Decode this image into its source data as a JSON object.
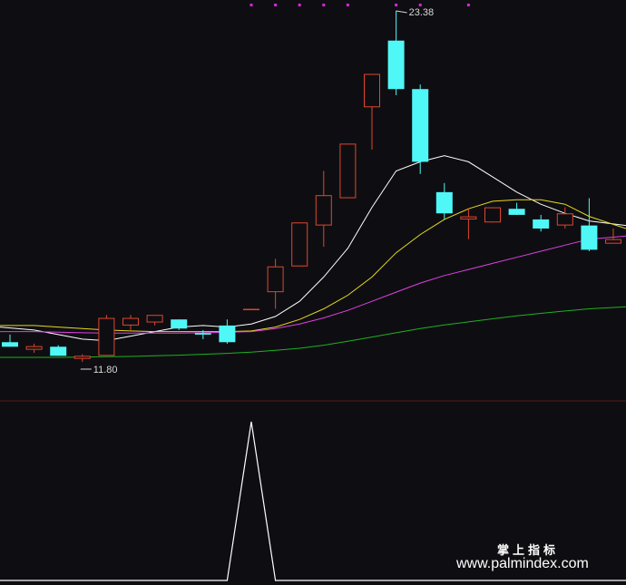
{
  "chart_data": [
    {
      "type": "candlestick",
      "ylim": [
        10.0,
        24.0
      ],
      "candles": [
        {
          "o": 12.45,
          "h": 12.7,
          "l": 12.3,
          "c": 12.3
        },
        {
          "o": 12.2,
          "h": 12.4,
          "l": 12.1,
          "c": 12.32
        },
        {
          "o": 12.3,
          "h": 12.35,
          "l": 12.0,
          "c": 12.0
        },
        {
          "o": 11.9,
          "h": 12.05,
          "l": 11.8,
          "c": 12.0
        },
        {
          "o": 12.0,
          "h": 13.35,
          "l": 12.0,
          "c": 13.25
        },
        {
          "o": 13.0,
          "h": 13.35,
          "l": 12.85,
          "c": 13.25
        },
        {
          "o": 13.1,
          "h": 13.35,
          "l": 13.0,
          "c": 13.35
        },
        {
          "o": 13.2,
          "h": 13.2,
          "l": 12.85,
          "c": 12.9
        },
        {
          "o": 12.75,
          "h": 12.85,
          "l": 12.55,
          "c": 12.7
        },
        {
          "o": 13.0,
          "h": 13.2,
          "l": 12.4,
          "c": 12.45
        },
        {
          "o": 13.55,
          "h": 13.55,
          "l": 13.55,
          "c": 13.55
        },
        {
          "o": 14.1,
          "h": 15.2,
          "l": 13.55,
          "c": 14.95
        },
        {
          "o": 14.95,
          "h": 16.4,
          "l": 14.95,
          "c": 16.4
        },
        {
          "o": 16.3,
          "h": 18.1,
          "l": 15.6,
          "c": 17.3
        },
        {
          "o": 17.2,
          "h": 19.0,
          "l": 17.2,
          "c": 19.0
        },
        {
          "o": 20.2,
          "h": 21.3,
          "l": 18.8,
          "c": 21.3
        },
        {
          "o": 22.4,
          "h": 23.38,
          "l": 20.6,
          "c": 20.8
        },
        {
          "o": 20.8,
          "h": 20.95,
          "l": 18.0,
          "c": 18.4
        },
        {
          "o": 17.4,
          "h": 17.7,
          "l": 16.5,
          "c": 16.7
        },
        {
          "o": 16.5,
          "h": 16.85,
          "l": 15.85,
          "c": 16.6
        },
        {
          "o": 16.4,
          "h": 16.9,
          "l": 16.4,
          "c": 16.9
        },
        {
          "o": 16.85,
          "h": 17.05,
          "l": 16.65,
          "c": 16.65
        },
        {
          "o": 16.5,
          "h": 16.65,
          "l": 16.1,
          "c": 16.2
        },
        {
          "o": 16.3,
          "h": 16.9,
          "l": 16.2,
          "c": 16.7
        },
        {
          "o": 16.3,
          "h": 17.2,
          "l": 15.45,
          "c": 15.5
        },
        {
          "o": 15.7,
          "h": 16.2,
          "l": 15.7,
          "c": 15.85
        }
      ],
      "moving_averages": [
        {
          "color": "#ffffff",
          "values": [
            12.95,
            12.85,
            12.7,
            12.55,
            12.5,
            12.65,
            12.8,
            12.95,
            13.0,
            12.95,
            13.05,
            13.3,
            13.8,
            14.6,
            15.55,
            16.9,
            18.1,
            18.4,
            18.6,
            18.4,
            17.9,
            17.4,
            17.0,
            16.7,
            16.45,
            16.3
          ]
        },
        {
          "color": "#e8d820",
          "values": [
            13.0,
            13.0,
            12.95,
            12.9,
            12.85,
            12.82,
            12.8,
            12.8,
            12.8,
            12.8,
            12.82,
            12.95,
            13.2,
            13.55,
            14.0,
            14.6,
            15.4,
            16.0,
            16.5,
            16.85,
            17.1,
            17.15,
            17.15,
            17.0,
            16.6,
            16.2
          ]
        },
        {
          "color": "#e040e0",
          "values": [
            12.8,
            12.8,
            12.78,
            12.76,
            12.75,
            12.75,
            12.75,
            12.75,
            12.76,
            12.78,
            12.8,
            12.9,
            13.05,
            13.25,
            13.5,
            13.8,
            14.1,
            14.4,
            14.65,
            14.85,
            15.05,
            15.25,
            15.45,
            15.65,
            15.85,
            15.95
          ]
        },
        {
          "color": "#20b020",
          "values": [
            11.95,
            11.95,
            11.95,
            11.96,
            11.97,
            11.98,
            12.0,
            12.02,
            12.05,
            12.08,
            12.12,
            12.18,
            12.25,
            12.35,
            12.48,
            12.62,
            12.76,
            12.9,
            13.02,
            13.12,
            13.22,
            13.32,
            13.4,
            13.48,
            13.55,
            13.62
          ]
        }
      ],
      "annotations": [
        {
          "label": "23.38",
          "candle": 16,
          "value": 23.38
        },
        {
          "label": "11.80",
          "candle": 3,
          "value": 11.8
        }
      ],
      "top_markers": [
        10,
        11,
        12,
        13,
        14,
        16,
        17,
        19
      ]
    },
    {
      "type": "line",
      "ylim": [
        0,
        1
      ],
      "values": [
        0,
        0,
        0,
        0,
        0,
        0,
        0,
        0,
        0,
        0,
        1,
        0,
        0,
        0,
        0,
        0,
        0,
        0,
        0,
        0,
        0,
        0,
        0,
        0,
        0,
        0
      ]
    }
  ],
  "watermark": {
    "line1": "掌上指标",
    "line2": "www.palmindex.com"
  },
  "colors": {
    "background": "#0e0e12",
    "up": "#e0452e",
    "down": "#4ff7f7",
    "divider": "#5a1616",
    "marker": "#e020e0",
    "indicator": "#ffffff"
  }
}
